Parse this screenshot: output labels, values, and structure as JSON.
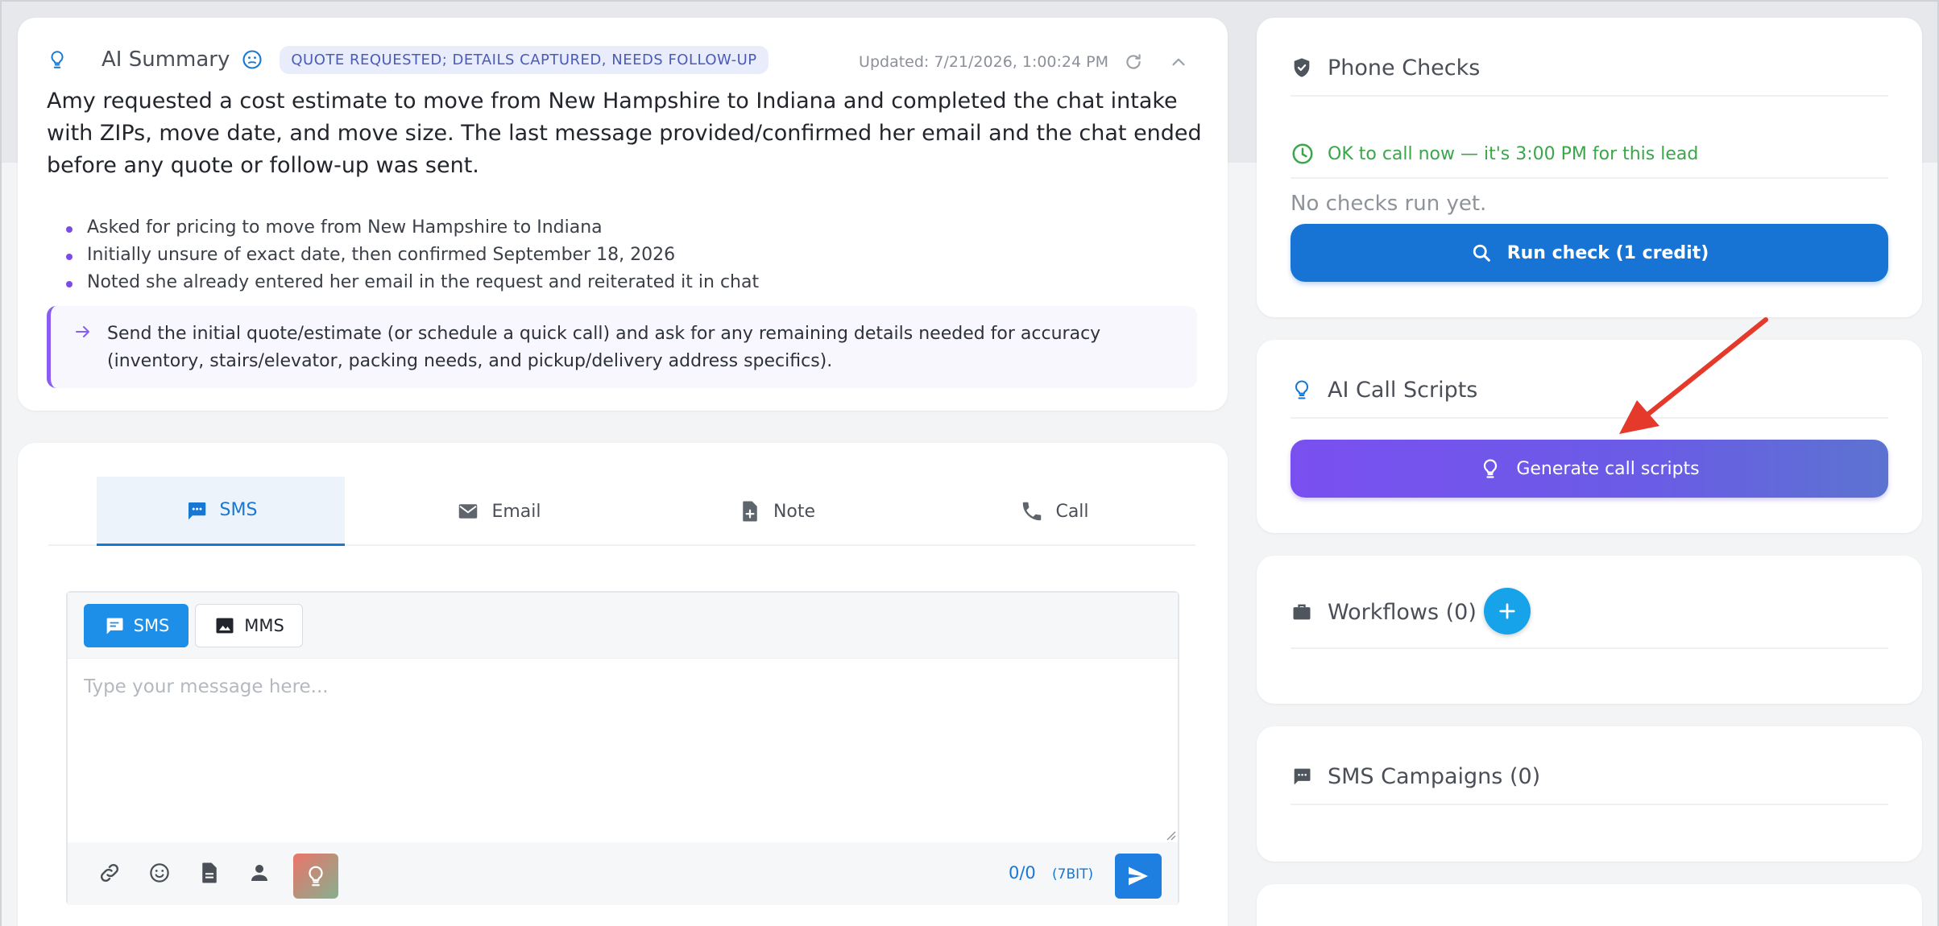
{
  "summary": {
    "title": "AI Summary",
    "status": "QUOTE REQUESTED; DETAILS CAPTURED, NEEDS FOLLOW-UP",
    "updated": "Updated: 7/21/2026, 1:00:24 PM",
    "paragraph": "Amy requested a cost estimate to move from New Hampshire to Indiana and completed the chat intake with ZIPs, move date, and move size. The last message provided/confirmed her email and the chat ended before any quote or follow-up was sent.",
    "bullets": [
      "Asked for pricing to move from New Hampshire to Indiana",
      "Initially unsure of exact date, then confirmed September 18, 2026",
      "Noted she already entered her email in the request and reiterated it in chat"
    ],
    "next_step": "Send the initial quote/estimate (or schedule a quick call) and ask for any remaining details needed for accuracy (inventory, stairs/elevator, packing needs, and pickup/delivery address specifics)."
  },
  "composer": {
    "tabs": [
      {
        "label": "SMS",
        "icon": "sms-icon"
      },
      {
        "label": "Email",
        "icon": "mail-icon"
      },
      {
        "label": "Note",
        "icon": "note-icon"
      },
      {
        "label": "Call",
        "icon": "phone-icon"
      }
    ],
    "active_tab": "SMS",
    "mode_sms": "SMS",
    "mode_mms": "MMS",
    "placeholder": "Type your message here...",
    "value": "",
    "counter": "0/0",
    "encoding": "(7BIT)",
    "tools": [
      "link-icon",
      "emoji-icon",
      "template-icon",
      "contact-icon",
      "ai-bulb-icon"
    ]
  },
  "phone_checks": {
    "title": "Phone Checks",
    "ok_text": "OK to call now — it's 3:00 PM for this lead",
    "no_checks": "No checks run yet.",
    "run_button": "Run check (1 credit)"
  },
  "call_scripts": {
    "title": "AI Call Scripts",
    "button": "Generate call scripts"
  },
  "workflows": {
    "title": "Workflows (0)"
  },
  "sms_campaigns": {
    "title": "SMS Campaigns (0)"
  },
  "colors": {
    "primary": "#1774d4",
    "sms_button": "#1e8fe8",
    "ok_green": "#3aa64a",
    "accent_purple": "#7a4ff0",
    "status_chip_text": "#4a5bb8",
    "annotation_red": "#e5392b"
  }
}
